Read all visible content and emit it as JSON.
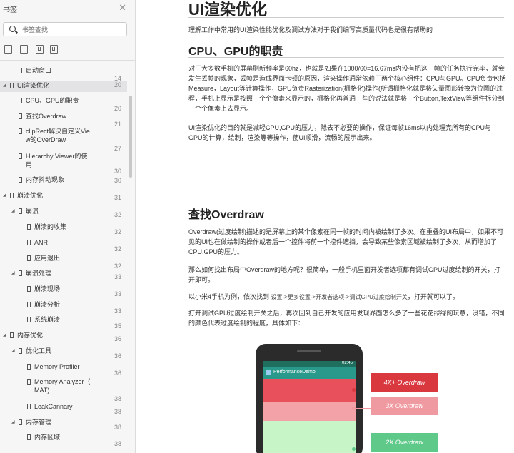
{
  "sidebar": {
    "title": "书签",
    "search_placeholder": "书签查找",
    "items": [
      {
        "label": "启动窗口",
        "page": "14",
        "level": 1,
        "arrow": false
      },
      {
        "label": "UI渲染优化",
        "page": "20",
        "level": 0,
        "arrow": true,
        "selected": true
      },
      {
        "label": "CPU、GPU的职责",
        "page": "20",
        "level": 1,
        "arrow": false
      },
      {
        "label": "查找Overdraw",
        "page": "21",
        "level": 1,
        "arrow": false
      },
      {
        "label": "clipRect解决自定义Vie",
        "label2": "w的OverDraw",
        "page": "27",
        "level": 1,
        "arrow": false
      },
      {
        "label": "Hierarchy Viewer的使",
        "label2": "用",
        "page": "30",
        "level": 1,
        "arrow": false
      },
      {
        "label": "内存抖动现象",
        "page": "30",
        "level": 1,
        "arrow": false
      },
      {
        "label": "崩溃优化",
        "page": "31",
        "level": 0,
        "arrow": true
      },
      {
        "label": "崩溃",
        "page": "32",
        "level": 1,
        "arrow": true
      },
      {
        "label": "崩溃的收集",
        "page": "32",
        "level": 2,
        "arrow": false
      },
      {
        "label": "ANR",
        "page": "32",
        "level": 2,
        "arrow": false
      },
      {
        "label": "应用退出",
        "page": "32",
        "level": 2,
        "arrow": false
      },
      {
        "label": "崩溃处理",
        "page": "33",
        "level": 1,
        "arrow": true
      },
      {
        "label": "崩溃现场",
        "page": "33",
        "level": 2,
        "arrow": false
      },
      {
        "label": "崩溃分析",
        "page": "33",
        "level": 2,
        "arrow": false
      },
      {
        "label": "系统崩溃",
        "page": "35",
        "level": 2,
        "arrow": false
      },
      {
        "label": "内存优化",
        "page": "36",
        "level": 0,
        "arrow": true
      },
      {
        "label": "优化工具",
        "page": "36",
        "level": 1,
        "arrow": true
      },
      {
        "label": "Memory Profiler",
        "page": "36",
        "level": 2,
        "arrow": false
      },
      {
        "label": "Memory Analyzer（",
        "label2": "MAT)",
        "page": "38",
        "level": 2,
        "arrow": false
      },
      {
        "label": "LeakCannary",
        "page": "38",
        "level": 2,
        "arrow": false
      },
      {
        "label": "内存管理",
        "page": "38",
        "level": 1,
        "arrow": true
      },
      {
        "label": "内存区域",
        "page": "38",
        "level": 2,
        "arrow": false
      }
    ]
  },
  "doc": {
    "h1": "UI渲染优化",
    "intro": "理解工作中常用的UI渲染性能优化及调试方法对于我们编写高质量代码也是很有帮助的",
    "h2a": "CPU、GPU的职责",
    "pa1": "对于大多数手机的屏幕刷新频率是60hz，也就是如果在1000/60=16.67ms内没有把这一帧的任务执行完毕，就会发生丢帧的现象，丢帧是造成界面卡顿的原因，渲染操作通常依赖于两个核心组件：CPU与GPU。CPU负责包括Measure，Layout等计算操作，GPU负责Rasterization(栅格化)操作(所谓栅格化就是将矢量图形转换为位图的过程，手机上显示是按照一个个像素来显示的，栅格化再普通一些的说法就是将一个Button,TextView等组件拆分到一个个像素上去显示。",
    "pa2": "UI渲染优化的目的就是减轻CPU,GPU的压力，除去不必要的操作，保证每帧16ms以内处理完所有的CPU与GPU的计算，绘制，渲染等等操作，使UI顺滑，流畅的展示出来。",
    "h2b": "查找Overdraw",
    "pb1": "Overdraw(过度绘制)描述的是屏幕上的某个像素在同一帧的时间内被绘制了多次。在重叠的UI布局中，如果不可见的UI也在做绘制的操作或者后一个控件将前一个控件遮挡，会导致某些像素区域被绘制了多次，从而增加了CPU,GPU的压力。",
    "pb2": "那么如何找出布局中Overdraw的地方呢？很简单，一般手机里面开发者选项都有调试GPU过度绘制的开关，打开即可。",
    "pb3_pre": "以小米4手机为例，依次找到 ",
    "pb3_code": "设置->更多设置->开发者选项->调试GPU过度绘制开关",
    "pb3_post": "，打开就可以了。",
    "pb4": "打开调试GPU过度绘制开关之后，再次回到自己开发的应用发现界面怎么多了一些花花绿绿的玩意，没错，不同的颜色代表过度绘制的程度，具体如下："
  },
  "figure": {
    "app_title": "PerformanceDemo",
    "time": "02:45",
    "label_4x": "4X+ Overdraw",
    "label_3x": "3X Overdraw",
    "label_2x": "2X Overdraw",
    "colors": {
      "red": "#e8505b",
      "pink": "#f3a2a8",
      "green": "#c8f5c8",
      "badge_red": "#d9383f",
      "badge_pink": "#ef9aa0",
      "badge_green": "#5fc98a"
    }
  }
}
